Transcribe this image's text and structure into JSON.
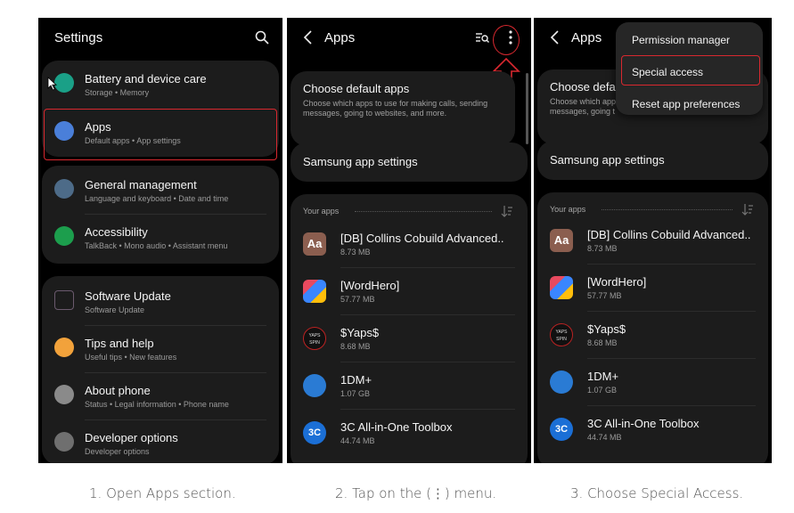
{
  "steps": [
    {
      "caption": "1. Open Apps section.",
      "screen": {
        "title": "Settings",
        "items": [
          {
            "label": "Battery and device care",
            "sub": "Storage  •  Memory",
            "color": "#1aa087"
          },
          {
            "label": "Apps",
            "sub": "Default apps  •  App settings",
            "color": "#4a7fd9"
          },
          {
            "label": "General management",
            "sub": "Language and keyboard  •  Date and time",
            "color": "#4d6b88"
          },
          {
            "label": "Accessibility",
            "sub": "TalkBack  •  Mono audio  •  Assistant menu",
            "color": "#1c9e4d"
          },
          {
            "label": "Software Update",
            "sub": "Software Update",
            "color": "#6b5a6e"
          },
          {
            "label": "Tips and help",
            "sub": "Useful tips  •  New features",
            "color": "#f2a23b"
          },
          {
            "label": "About phone",
            "sub": "Status  •  Legal information  •  Phone name",
            "color": "#8a8a8a"
          },
          {
            "label": "Developer options",
            "sub": "Developer options",
            "color": "#6f6f6f"
          }
        ]
      }
    },
    {
      "caption": "2. Tap on the (⋮) menu.",
      "screen": {
        "title": "Apps",
        "default_apps": {
          "title": "Choose default apps",
          "sub": "Choose which apps to use for making calls, sending messages, going to websites, and more."
        },
        "samsung": "Samsung app settings",
        "your_apps": "Your apps",
        "apps": [
          {
            "name": "[DB] Collins Cobuild Advanced..",
            "size": "8.73 MB"
          },
          {
            "name": "[WordHero]",
            "size": "57.77 MB"
          },
          {
            "name": "$Yaps$",
            "size": "8.68 MB"
          },
          {
            "name": "1DM+",
            "size": "1.07 GB"
          },
          {
            "name": "3C All-in-One Toolbox",
            "size": "44.74 MB"
          }
        ]
      }
    },
    {
      "caption": "3. Choose Special Access.",
      "screen": {
        "title": "Apps",
        "default_apps": {
          "title": "Choose defa",
          "sub": "Choose which app\nmessages, going t"
        },
        "samsung": "Samsung app settings",
        "your_apps": "Your apps",
        "menu": [
          "Permission manager",
          "Special access",
          "Reset app preferences"
        ],
        "apps": [
          {
            "name": "[DB] Collins Cobuild Advanced..",
            "size": "8.73 MB"
          },
          {
            "name": "[WordHero]",
            "size": "57.77 MB"
          },
          {
            "name": "$Yaps$",
            "size": "8.68 MB"
          },
          {
            "name": "1DM+",
            "size": "1.07 GB"
          },
          {
            "name": "3C All-in-One Toolbox",
            "size": "44.74 MB"
          }
        ]
      }
    }
  ],
  "icons": {
    "aa": "Aa",
    "yaps": "YAPS\nSPIN",
    "threec": "3C"
  },
  "colors": {
    "highlight": "#d9282f",
    "card": "#1c1c1c",
    "menu": "#262626"
  }
}
